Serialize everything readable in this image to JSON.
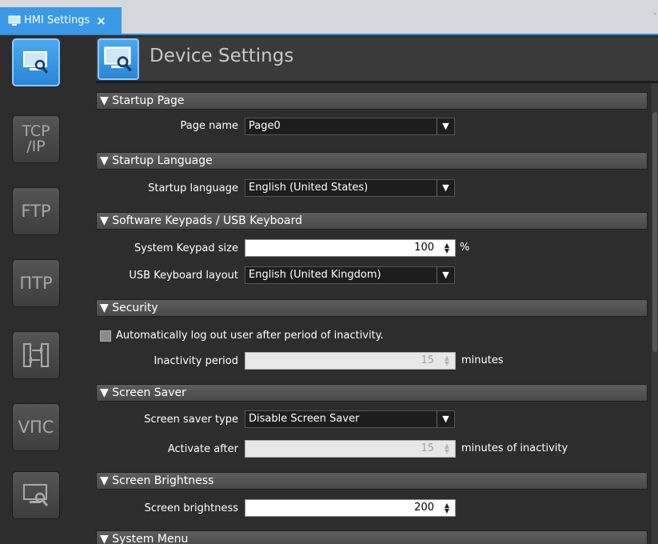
{
  "tab": {
    "label": "HMI Settings",
    "close": "×"
  },
  "header": {
    "title": "Device Settings"
  },
  "rail": {
    "tcp_label_1": "TCP",
    "tcp_label_2": "/IP",
    "ftp_label": "FTP",
    "ntp_label": "ΠTP",
    "vnc_label": "VΠC"
  },
  "sections": {
    "startup_page": "▼ Startup Page",
    "startup_language": "▼ Startup Language",
    "keypads": "▼ Software Keypads / USB Keyboard",
    "security": "▼ Security",
    "screen_saver": "▼ Screen Saver",
    "brightness": "▼ Screen Brightness",
    "system_menu": "▼ System Menu"
  },
  "fields": {
    "page_name": {
      "label": "Page name",
      "value": "Page0"
    },
    "startup_language": {
      "label": "Startup language",
      "value": "English (United States)"
    },
    "keypad_size": {
      "label": "System Keypad size",
      "value": "100",
      "unit": "%"
    },
    "usb_layout": {
      "label": "USB Keyboard layout",
      "value": "English (United Kingdom)"
    },
    "auto_logout": {
      "label": "Automatically log out user after period of inactivity.",
      "checked": false
    },
    "inactivity_period": {
      "label": "Inactivity period",
      "value": "15",
      "unit": "minutes"
    },
    "screen_saver_type": {
      "label": "Screen saver type",
      "value": "Disable Screen Saver"
    },
    "activate_after": {
      "label": "Activate after",
      "value": "15",
      "unit": "minutes of inactivity"
    },
    "brightness": {
      "label": "Screen brightness",
      "value": "200"
    }
  },
  "colors": {
    "accent": "#3a9ae5",
    "background": "#2d2d2d",
    "section_bar": "#555555"
  }
}
